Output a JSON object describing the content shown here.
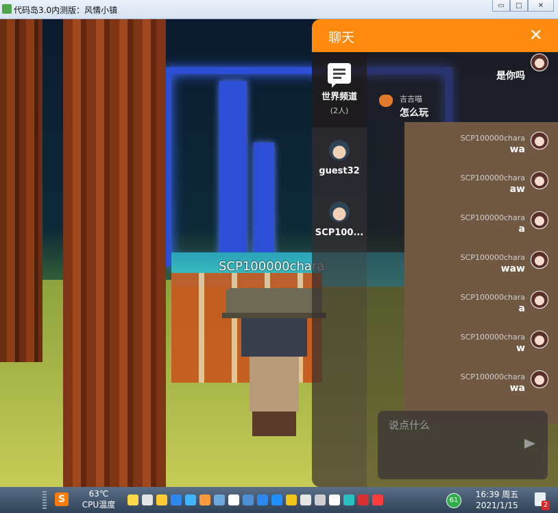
{
  "window": {
    "title": "代码岛3.0内测版：风情小镇",
    "minimize_glyph": "▭",
    "maximize_glyph": "□",
    "close_glyph": "✕"
  },
  "scene": {
    "player_name": "SCP100000chara"
  },
  "chat": {
    "title": "聊天",
    "close_glyph": "✕",
    "channels": [
      {
        "name": "世界频道",
        "sub": "(2人)",
        "icon": "chat-bubble-icon",
        "active": true
      },
      {
        "name": "guest32",
        "sub": "",
        "icon": "avatar-icon",
        "active": false
      },
      {
        "name": "SCP100...",
        "sub": "",
        "icon": "avatar-icon",
        "active": false
      }
    ],
    "messages_right_top": {
      "text": "是你吗"
    },
    "message_left": {
      "sender": "吉吉喵",
      "text": "怎么玩"
    },
    "messages": [
      {
        "sender": "SCP100000chara",
        "text": "wa"
      },
      {
        "sender": "SCP100000chara",
        "text": "aw"
      },
      {
        "sender": "SCP100000chara",
        "text": "a"
      },
      {
        "sender": "SCP100000chara",
        "text": "waw"
      },
      {
        "sender": "SCP100000chara",
        "text": "a"
      },
      {
        "sender": "SCP100000chara",
        "text": "w"
      },
      {
        "sender": "SCP100000chara",
        "text": "wa"
      }
    ],
    "input_placeholder": "说点什么",
    "send_icon": "send-icon"
  },
  "taskbar": {
    "s_label": "S",
    "cpu_temp": "63℃",
    "cpu_label": "CPU温度",
    "badge_count": "61",
    "time": "16:39 周五",
    "date": "2021/1/15",
    "notification_count": "2",
    "tray_colors": [
      "#ffd84a",
      "#e5e5e5",
      "#ffcc33",
      "#2d89ef",
      "#3fb5ff",
      "#ff9a3c",
      "#6fa8dc",
      "#ffffff",
      "#4b8fd6",
      "#2d89ef",
      "#1e90ff",
      "#f0c419",
      "#e6e6e6",
      "#cfcfcf",
      "#ffffff",
      "#28c1c1",
      "#d63030",
      "#ff3d3d"
    ]
  },
  "colors": {
    "chat_header": "#ff8a0d",
    "cage_blue": "#2c4fd6"
  }
}
